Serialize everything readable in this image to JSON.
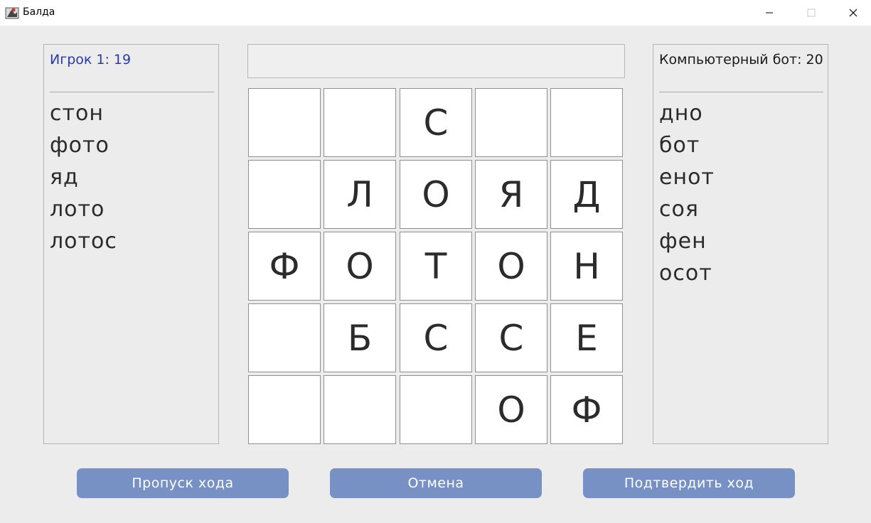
{
  "window": {
    "title": "Балда"
  },
  "player": {
    "score_label": "Игрок 1: 19",
    "words": [
      "стон",
      "фото",
      "яд",
      "лото",
      "лотос"
    ]
  },
  "bot": {
    "score_label": "Компьютерный бот: 20",
    "words": [
      "дно",
      "бот",
      "енот",
      "соя",
      "фен",
      "осот"
    ]
  },
  "current_word": "",
  "board": [
    [
      "",
      "",
      "С",
      "",
      ""
    ],
    [
      "",
      "Л",
      "О",
      "Я",
      "Д"
    ],
    [
      "Ф",
      "О",
      "Т",
      "О",
      "Н"
    ],
    [
      "",
      "Б",
      "С",
      "С",
      "Е"
    ],
    [
      "",
      "",
      "",
      "О",
      "Ф"
    ]
  ],
  "buttons": {
    "skip": "Пропуск хода",
    "cancel": "Отмена",
    "confirm": "Подтвердить ход"
  },
  "colors": {
    "button_bg": "#7791c5",
    "player_score": "#2a3aa8",
    "background": "#ececec"
  }
}
